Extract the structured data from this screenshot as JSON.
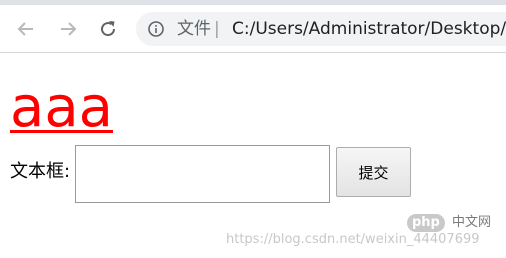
{
  "browser": {
    "scheme_label": "文件",
    "separator": "|",
    "url": "C:/Users/Administrator/Desktop/",
    "icons": {
      "back": "arrow-left-icon",
      "forward": "arrow-right-icon",
      "reload": "reload-icon",
      "site_info": "info-circle-icon"
    }
  },
  "page": {
    "heading_link": "aaa",
    "heading_color": "#ff0000",
    "form": {
      "field_label": "文本框:",
      "input_value": "",
      "submit_label": "提交"
    }
  },
  "watermark": {
    "badge": "php",
    "site_name": "中文网",
    "url": "https://blog.csdn.net/weixin_44407699"
  }
}
